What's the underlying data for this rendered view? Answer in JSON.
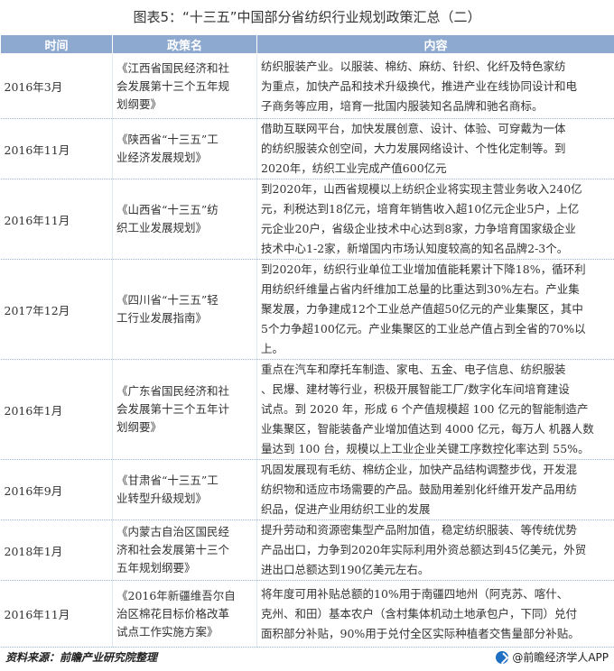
{
  "title": "图表5：“十三五”中国部分省纺织行业规划政策汇总（二）",
  "columns": {
    "time": "时间",
    "policy": "政策名",
    "content": "内容"
  },
  "rows": [
    {
      "time": "2016年3月",
      "policy": [
        "《江西省国民经济和社",
        "会发展第十三个五年规",
        "划纲要》"
      ],
      "content": [
        "纺织服装产业。以服装、棉纺、麻纺、针织、化纤及特色家纺",
        "为重点，加快产品和技术升级换代，推进产业在线协同设计和电",
        "子商务等应用，培育一批国内服装知名品牌和驰名商标。"
      ]
    },
    {
      "time": "2016年11月",
      "policy": [
        "《陕西省“十三五”工",
        "业经济发展规划》"
      ],
      "content": [
        "借助互联网平台，加快发展创意、设计、体验、可穿戴为一体",
        "的纺织服装众创空间，大力发展网络设计、个性化定制等。到",
        "2020年，纺织工业完成产值600亿元"
      ]
    },
    {
      "time": "2016年11月",
      "policy": [
        "《山西省“十三五”纺",
        "织工业发展规划》"
      ],
      "content": [
        "到2020年，山西省规模以上纺织企业将实现主营业务收入240亿",
        "元，利税达到18亿元，培育年销售收入超10亿元企业5户，上亿",
        "元企业20户，省级企业技术中心达到8家，力争培育国家级企业",
        "技术中心1-2家，新增国内市场认知度较高的知名品牌2-3个。"
      ]
    },
    {
      "time": "2017年12月",
      "policy": [
        "《四川省“十三五”轻",
        "工行业发展指南》"
      ],
      "content": [
        "到2020年，纺织行业单位工业增加值能耗累计下降18%，循环利",
        "用纺织纤维量占省内纤维加工总量的比重达到30%左右。产业集",
        "聚发展，力争建成12个工业总产值超50亿元的产业集聚区，其中",
        "5个力争超100亿元。产业集聚区的工业总产值占到全省的70%以",
        "上。"
      ]
    },
    {
      "time": "2016年1月",
      "policy": [
        "《广东省国民经济和社",
        "会发展第十三个五年计",
        "划纲要》"
      ],
      "content": [
        "重点在汽车和摩托车制造、家电、五金、电子信息、纺织服装",
        "、民爆、建材等行业，积极开展智能工厂/数字化车间培育建设",
        "试点。到 2020 年，形成 6 个产值规模超 100 亿元的智能制造产",
        "业集聚区，智能装备产业增加值达到 4000 亿元，每万人 机器人数",
        "量达到 100 台，规模以上工业企业关键工序数控化率达到 55%。"
      ]
    },
    {
      "time": "2016年9月",
      "policy": [
        "《甘肃省“十三五”工",
        "业转型升级规划》"
      ],
      "content": [
        "巩固发展现有毛纺、棉纺企业，加快产品结构调整步伐，开发混",
        "纺织物和适应市场需要的产品。鼓励用差别化纤维开发产品用纺",
        "织品，促进产业用纺织工业的发展"
      ]
    },
    {
      "time": "2018年1月",
      "policy": [
        "《内蒙古自治区国民经",
        "济和社会发展第十三个",
        "五年规划纲要》"
      ],
      "content": [
        "提升劳动和资源密集型产品附加值，稳定纺织服装、等传统优势",
        "产品出口，力争到2020年实际利用外资总额达到45亿美元，外贸",
        "进出口总额达到190亿美元左右。"
      ]
    },
    {
      "time": "2016年11月",
      "policy": [
        "《2016年新疆维吾尔自",
        "治区棉花目标价格改革",
        "试点工作实施方案》"
      ],
      "content": [
        "将年度可用补贴总额的10%用于南疆四地州（阿克苏、喀什、",
        "克州、和田）基本农户（含村集体机动土地承包户，下同）兑付",
        "面积部分补贴，90%用于兑付全区实际种植者交售量部分补贴。"
      ]
    }
  ],
  "footer": {
    "source": "资料来源：前瞻产业研究院整理",
    "brand": "@前瞻经济学人APP"
  }
}
